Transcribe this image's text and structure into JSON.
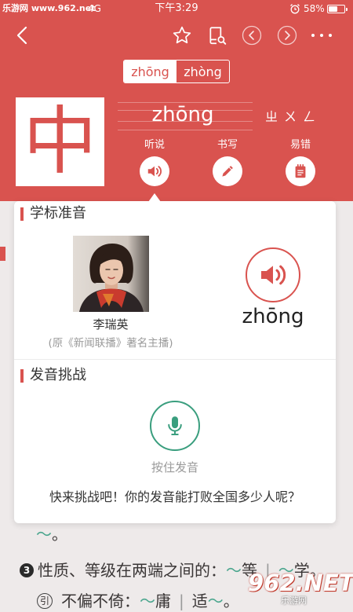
{
  "status_bar": {
    "watermark": "乐游网 www.962.net",
    "network": "4G",
    "time": "下午3:29",
    "battery_text": "58%",
    "battery_level": 0.58,
    "alarm_icon": "alarm-clock-icon"
  },
  "toolbar": {
    "back_icon": "back-arrow-icon",
    "favorite_icon": "star-icon",
    "lookup_icon": "book-search-icon",
    "prev_icon": "previous-circle-icon",
    "next_icon": "next-circle-icon",
    "more_icon": "more-dots-icon"
  },
  "pronunciation_tabs": [
    {
      "label": "zhōng",
      "selected": true
    },
    {
      "label": "zhòng",
      "selected": false
    }
  ],
  "entry": {
    "character": "中",
    "pinyin": "zhōng",
    "zhuyin": "ㄓㄨㄥ"
  },
  "actions": [
    {
      "label": "听说",
      "icon": "speaker-icon"
    },
    {
      "label": "书写",
      "icon": "pencil-icon"
    },
    {
      "label": "易错",
      "icon": "notepad-icon"
    }
  ],
  "popup": {
    "standard_section": {
      "title": "学标准音",
      "announcer_name": "李瑞英",
      "announcer_note": "(原《新闻联播》著名主播)",
      "play_icon": "speaker-icon",
      "pinyin": "zhōng"
    },
    "challenge_section": {
      "title": "发音挑战",
      "mic_icon": "microphone-icon",
      "hold_hint": "按住发音",
      "prompt": "快来挑战吧！你的发音能打败全国多少人呢？"
    }
  },
  "definitions_behind": [
    {
      "marker": "",
      "segments": [
        "～",
        "。"
      ]
    },
    {
      "marker": "3",
      "segments": [
        "性质、等级在两端之间的：",
        "～",
        "等",
        "|",
        "～",
        "学。"
      ]
    },
    {
      "marker": "引",
      "segments": [
        "不偏不倚：",
        "～",
        "庸",
        "|",
        "适",
        "～",
        "。"
      ]
    }
  ],
  "bottom_watermark": {
    "brand": "962.NET",
    "name": "乐游网"
  },
  "colors": {
    "accent": "#d9534f",
    "mic_green": "#3a9e7e",
    "headword_tilde": "#4ba68e"
  }
}
